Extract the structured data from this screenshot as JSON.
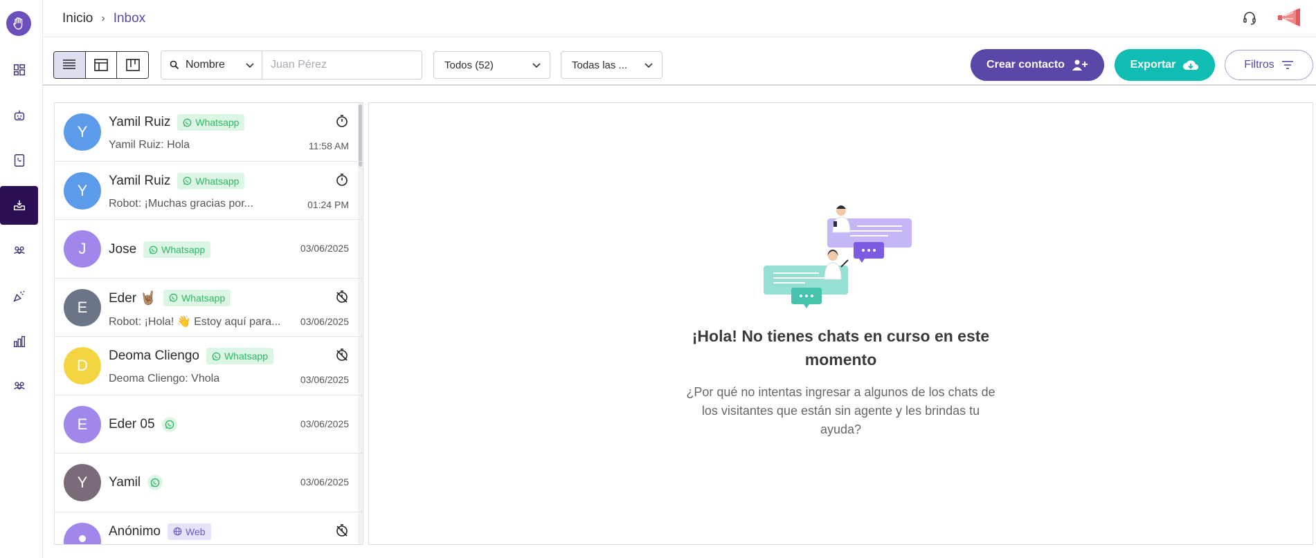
{
  "header": {
    "breadcrumb_home": "Inicio",
    "breadcrumb_current": "Inbox"
  },
  "toolbar": {
    "search_field_select": "Nombre",
    "search_placeholder": "Juan Pérez",
    "status_filter": "Todos (52)",
    "category_filter": "Todas las ...",
    "create_contact_label": "Crear contacto",
    "export_label": "Exportar",
    "filters_label": "Filtros"
  },
  "chats": [
    {
      "initial": "Y",
      "name": "Yamil Ruiz",
      "channel": "Whatsapp",
      "preview": "Yamil Ruiz: Hola",
      "time": "11:58 AM",
      "color": "#5b9bea",
      "timer": "active"
    },
    {
      "initial": "Y",
      "name": "Yamil Ruiz",
      "channel": "Whatsapp",
      "preview": "Robot: ¡Muchas gracias por...",
      "time": "01:24 PM",
      "color": "#5b9bea",
      "timer": "active"
    },
    {
      "initial": "J",
      "name": "Jose",
      "channel": "Whatsapp",
      "preview": "",
      "time": "03/06/2025",
      "color": "#9f87ec",
      "timer": "none"
    },
    {
      "initial": "E",
      "name": "Eder 🤘🏽",
      "channel": "Whatsapp",
      "preview": "Robot: ¡Hola! 👋 Estoy aquí para...",
      "time": "03/06/2025",
      "color": "#6b7587",
      "timer": "off"
    },
    {
      "initial": "D",
      "name": "Deoma Cliengo",
      "channel": "Whatsapp",
      "preview": "Deoma Cliengo: Vhola",
      "time": "03/06/2025",
      "color": "#f5d442",
      "timer": "off"
    },
    {
      "initial": "E",
      "name": "Eder 05",
      "channel": "",
      "preview": "",
      "time": "03/06/2025",
      "color": "#9f87ec",
      "timer": "none"
    },
    {
      "initial": "Y",
      "name": "Yamil",
      "channel": "",
      "preview": "",
      "time": "03/06/2025",
      "color": "#7b6a77",
      "timer": "none"
    },
    {
      "initial": "",
      "name": "Anónimo",
      "channel": "Web",
      "preview": "",
      "time": "",
      "color": "#9f87ec",
      "timer": "off"
    }
  ],
  "empty_state": {
    "title": "¡Hola! No tienes chats en curso en este momento",
    "description": "¿Por qué no intentas ingresar a algunos de los chats de los visitantes que están sin agente y les brindas tu ayuda?"
  },
  "colors": {
    "primary": "#5a47a8",
    "teal": "#0fbdb3",
    "sidebar_active": "#2a0f54",
    "whatsapp_badge_bg": "#dcf5e4",
    "whatsapp_badge_fg": "#2fb866"
  }
}
